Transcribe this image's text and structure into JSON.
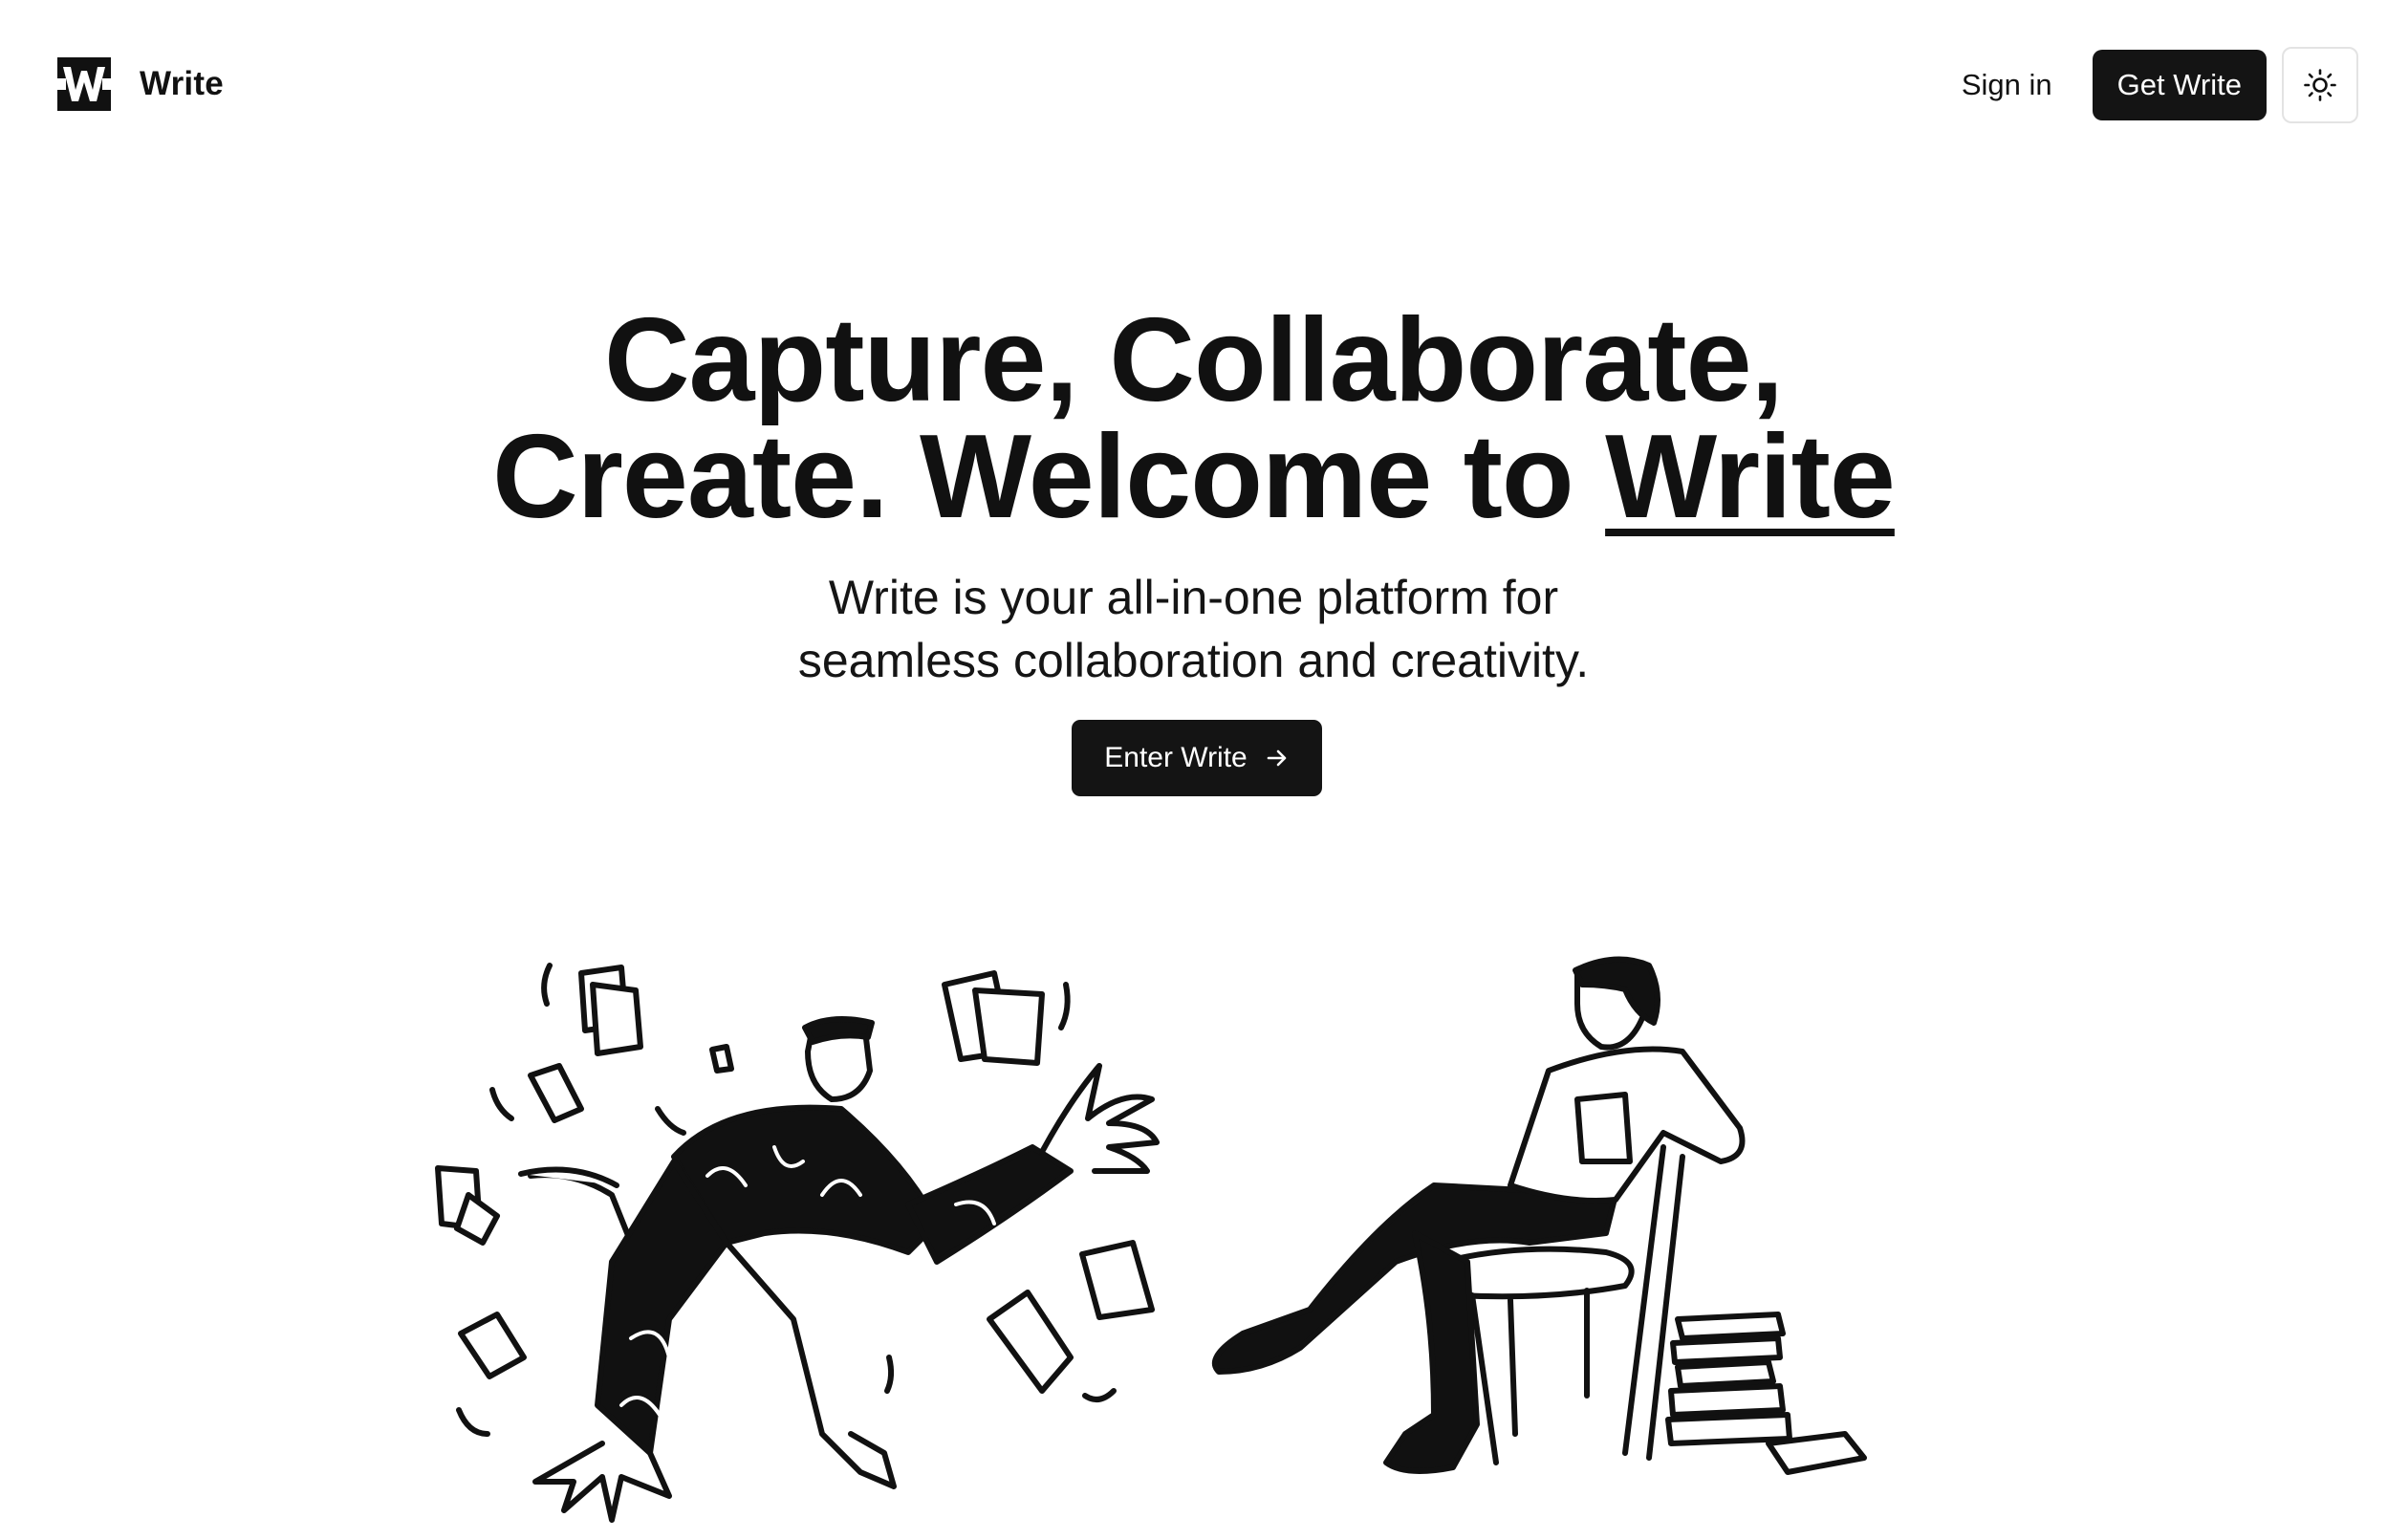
{
  "header": {
    "brand_name": "Write",
    "signin_label": "Sign in",
    "get_label": "Get Write"
  },
  "hero": {
    "title_line1": "Capture, Collaborate,",
    "title_line2_prefix": "Create. Welcome to ",
    "title_brand": "Write",
    "subtitle_line1": "Write is your all-in-one platform for",
    "subtitle_line2": "seamless collaboration and creativity.",
    "cta_label": "Enter Write"
  },
  "icons": {
    "logo": "w-logo-icon",
    "theme": "sun-icon",
    "cta": "arrow-right-icon"
  },
  "colors": {
    "primary": "#141414",
    "background": "#ffffff",
    "border": "#e3e3e3"
  }
}
